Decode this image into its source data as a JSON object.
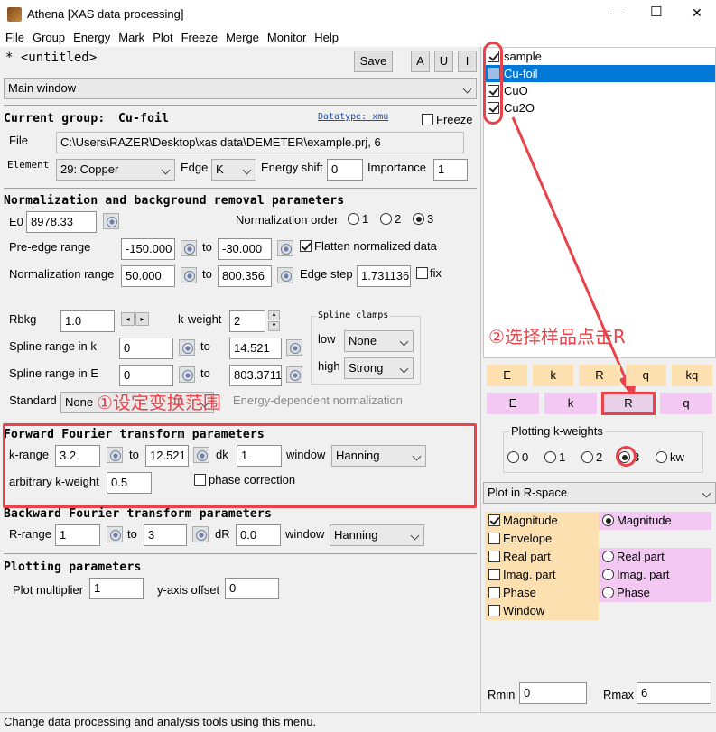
{
  "window": {
    "title": "Athena [XAS data processing]",
    "min": "—",
    "max": "☐",
    "close": "✕"
  },
  "menu": [
    "File",
    "Group",
    "Energy",
    "Mark",
    "Plot",
    "Freeze",
    "Merge",
    "Monitor",
    "Help"
  ],
  "project": {
    "name": "* <untitled>",
    "save": "Save",
    "a": "A",
    "u": "U",
    "i": "I"
  },
  "main_select": "Main window",
  "group": {
    "current_label": "Current group:",
    "current_value": "Cu-foil",
    "datatype": "Datatype: xmu",
    "freeze": "Freeze",
    "file_label": "File",
    "file_value": "C:\\Users\\RAZER\\Desktop\\xas data\\DEMETER\\example.prj, 6",
    "element_label": "Element",
    "element_value": "29: Copper",
    "edge_label": "Edge",
    "edge_value": "K",
    "eshift_label": "Energy shift",
    "eshift_value": "0",
    "importance_label": "Importance",
    "importance_value": "1"
  },
  "norm": {
    "header": "Normalization and background removal parameters",
    "e0_label": "E0",
    "e0_value": "8978.33",
    "order_label": "Normalization order",
    "order_options": [
      "1",
      "2",
      "3"
    ],
    "order_selected": "3",
    "preedge_label": "Pre-edge range",
    "preedge_from": "-150.000",
    "preedge_to": "-30.000",
    "to": "to",
    "flatten_label": "Flatten normalized data",
    "normrange_label": "Normalization range",
    "normrange_from": "50.000",
    "normrange_to": "800.356",
    "edgestep_label": "Edge step",
    "edgestep_value": "1.731136",
    "fix_label": "fix",
    "rbkg_label": "Rbkg",
    "rbkg_value": "1.0",
    "kweight_label": "k-weight",
    "kweight_value": "2",
    "clamps_label": "Spline clamps",
    "low_label": "low",
    "low_value": "None",
    "high_label": "high",
    "high_value": "Strong",
    "splinek_label": "Spline range in k",
    "splinek_from": "0",
    "splinek_to": "14.521",
    "splinee_label": "Spline range in E",
    "splinee_from": "0",
    "splinee_to": "803.3711",
    "standard_label": "Standard",
    "standard_value": "None",
    "energydep_label": "Energy-dependent normalization"
  },
  "fft": {
    "header": "Forward Fourier transform parameters",
    "krange_label": "k-range",
    "krange_from": "3.2",
    "to": "to",
    "krange_to": "12.521",
    "dk_label": "dk",
    "dk_value": "1",
    "window_label": "window",
    "window_value": "Hanning",
    "arbk_label": "arbitrary k-weight",
    "arbk_value": "0.5",
    "phase_label": "phase correction"
  },
  "bft": {
    "header": "Backward Fourier transform parameters",
    "rrange_label": "R-range",
    "rrange_from": "1",
    "to": "to",
    "rrange_to": "3",
    "dr_label": "dR",
    "dr_value": "0.0",
    "window_label": "window",
    "window_value": "Hanning"
  },
  "plotting": {
    "header": "Plotting parameters",
    "mult_label": "Plot multiplier",
    "mult_value": "1",
    "yoff_label": "y-axis offset",
    "yoff_value": "0"
  },
  "status": "Change data processing and analysis tools using this menu.",
  "groups": [
    {
      "name": "sample",
      "checked": true,
      "selected": false
    },
    {
      "name": "Cu-foil",
      "checked": false,
      "selected": true
    },
    {
      "name": "CuO",
      "checked": true,
      "selected": false
    },
    {
      "name": "Cu2O",
      "checked": true,
      "selected": false
    }
  ],
  "plot_row1": [
    "E",
    "k",
    "R",
    "q",
    "kq"
  ],
  "plot_row2": [
    "E",
    "k",
    "R",
    "q"
  ],
  "kweights": {
    "title": "Plotting k-weights",
    "options": [
      "0",
      "1",
      "2",
      "3",
      "kw"
    ],
    "selected": "3"
  },
  "plot_space": "Plot in R-space",
  "plot_options_left": [
    {
      "label": "Magnitude",
      "checked": true
    },
    {
      "label": "Envelope",
      "checked": false
    },
    {
      "label": "Real part",
      "checked": false
    },
    {
      "label": "Imag. part",
      "checked": false
    },
    {
      "label": "Phase",
      "checked": false
    },
    {
      "label": "Window",
      "checked": false
    }
  ],
  "plot_options_right": [
    {
      "label": "Magnitude",
      "checked": true
    },
    {
      "label": "Real part",
      "checked": false
    },
    {
      "label": "Imag. part",
      "checked": false
    },
    {
      "label": "Phase",
      "checked": false
    }
  ],
  "rmin_label": "Rmin",
  "rmin_value": "0",
  "rmax_label": "Rmax",
  "rmax_value": "6",
  "annotations": {
    "step1": "①设定变换范围",
    "step2": "②选择样品点击R"
  },
  "colors": {
    "highlight": "#0078d7",
    "orange_btn": "#fde0b0",
    "pink_btn": "#f3c8f3",
    "annotation": "#e8434a"
  }
}
